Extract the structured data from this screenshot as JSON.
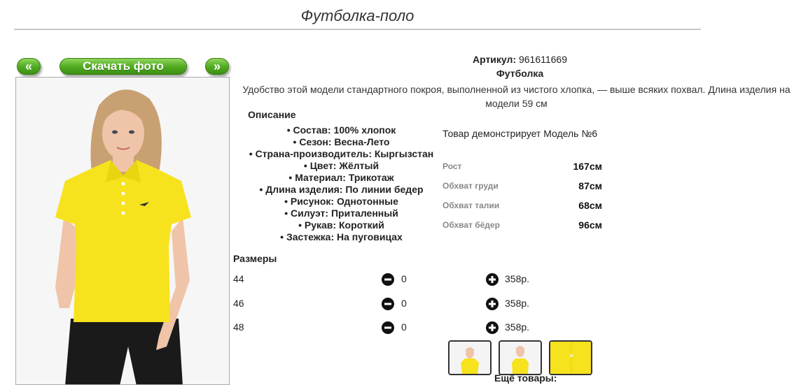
{
  "page": {
    "title": "Футболка-поло"
  },
  "gallery": {
    "prev_label": "«",
    "download_label": "Скачать фото",
    "next_label": "»"
  },
  "product": {
    "article_label": "Артикул:",
    "article_value": "961611669",
    "type": "Футболка",
    "description": "Удобство этой модели стандартного покроя, выполненной из чистого хлопка, — выше всяких похвал. Длина изделия на модели 59 см",
    "description_heading": "Описание",
    "properties": [
      "Состав: 100% хлопок",
      "Сезон: Весна-Лето",
      "Страна-производитель: Кыргызстан",
      "Цвет: Жёлтый",
      "Материал: Трикотаж",
      "Длина изделия: По линии бедер",
      "Рисунок: Однотонные",
      "Силуэт: Приталенный",
      "Рукав: Короткий",
      "Застежка: На пуговицах"
    ]
  },
  "model": {
    "caption": "Товар демонстрирует Модель №6",
    "measurements": [
      {
        "label": "Рост",
        "value": "167см"
      },
      {
        "label": "Обхват груди",
        "value": "87см"
      },
      {
        "label": "Обхват талии",
        "value": "68см"
      },
      {
        "label": "Обхват бёдер",
        "value": "96см"
      }
    ]
  },
  "sizes": {
    "heading": "Размеры",
    "rows": [
      {
        "size": "44",
        "qty": "0",
        "price": "358р."
      },
      {
        "size": "46",
        "qty": "0",
        "price": "358р."
      },
      {
        "size": "48",
        "qty": "0",
        "price": "358р."
      }
    ]
  },
  "more_products_label": "Ещё товары:",
  "colors": {
    "button_green": "#4ea91f",
    "shirt_yellow": "#f7e21e",
    "pants_black": "#1a1a1a",
    "skin": "#f0c4a8",
    "hair": "#c9a072"
  },
  "icons": {
    "minus": "minus-circle-icon",
    "plus": "plus-circle-icon"
  }
}
